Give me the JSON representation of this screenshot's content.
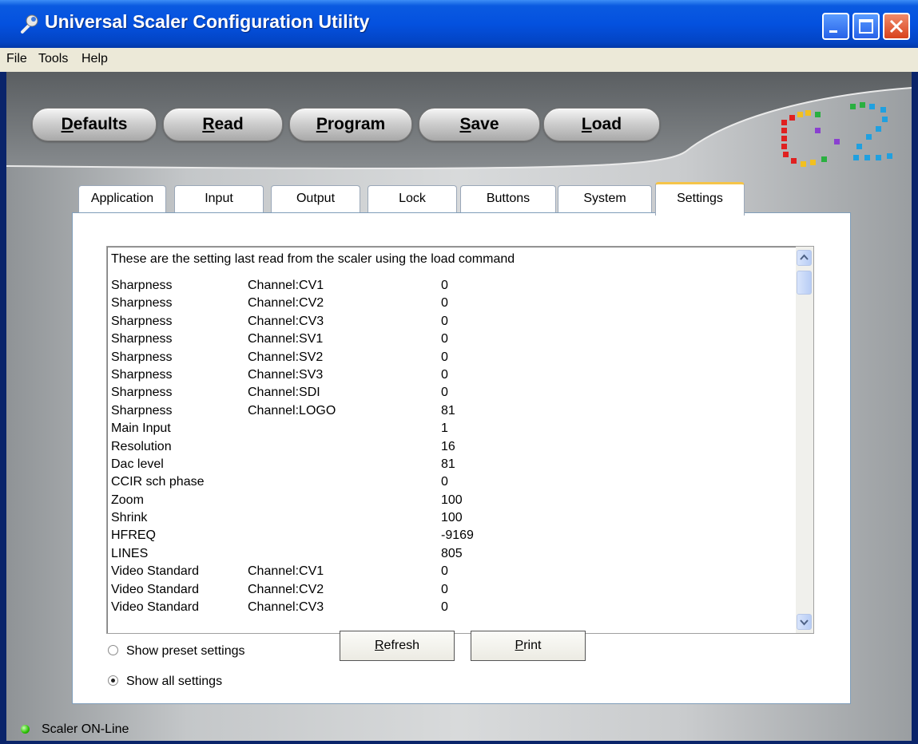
{
  "window": {
    "title": "Universal Scaler Configuration Utility"
  },
  "menu": [
    "File",
    "Tools",
    "Help"
  ],
  "toolbar": {
    "buttons": [
      {
        "label_u": "D",
        "label_rest": "efaults"
      },
      {
        "label_u": "R",
        "label_rest": "ead"
      },
      {
        "label_u": "P",
        "label_rest": "rogram"
      },
      {
        "label_u": "S",
        "label_rest": "ave"
      },
      {
        "label_u": "L",
        "label_rest": "oad"
      }
    ]
  },
  "tabs": [
    "Application",
    "Input",
    "Output",
    "Lock",
    "Buttons",
    "System",
    "Settings"
  ],
  "active_tab": "Settings",
  "settings": {
    "header": "These are the setting last read from the scaler using the load command",
    "rows": [
      {
        "name": "Sharpness",
        "channel": "Channel:CV1",
        "value": "0"
      },
      {
        "name": "Sharpness",
        "channel": "Channel:CV2",
        "value": "0"
      },
      {
        "name": "Sharpness",
        "channel": "Channel:CV3",
        "value": "0"
      },
      {
        "name": "Sharpness",
        "channel": "Channel:SV1",
        "value": "0"
      },
      {
        "name": "Sharpness",
        "channel": "Channel:SV2",
        "value": "0"
      },
      {
        "name": "Sharpness",
        "channel": "Channel:SV3",
        "value": "0"
      },
      {
        "name": "Sharpness",
        "channel": "Channel:SDI",
        "value": "0"
      },
      {
        "name": "Sharpness",
        "channel": "Channel:LOGO",
        "value": "81"
      },
      {
        "name": "Main Input",
        "channel": "",
        "value": "1"
      },
      {
        "name": "Resolution",
        "channel": "",
        "value": "16"
      },
      {
        "name": "Dac level",
        "channel": "",
        "value": "81"
      },
      {
        "name": "CCIR sch phase",
        "channel": "",
        "value": "0"
      },
      {
        "name": "Zoom",
        "channel": "",
        "value": "100"
      },
      {
        "name": "Shrink",
        "channel": "",
        "value": "100"
      },
      {
        "name": "HFREQ",
        "channel": "",
        "value": "-9169"
      },
      {
        "name": "LINES",
        "channel": "",
        "value": "805"
      },
      {
        "name": "Video Standard",
        "channel": "Channel:CV1",
        "value": "0"
      },
      {
        "name": "Video Standard",
        "channel": "Channel:CV2",
        "value": "0"
      },
      {
        "name": "Video Standard",
        "channel": "Channel:CV3",
        "value": "0"
      }
    ],
    "radio_preset": "Show preset settings",
    "radio_all": "Show all settings",
    "selected_radio": "all",
    "refresh_u": "R",
    "refresh_rest": "efresh",
    "print_u": "P",
    "print_rest": "rint"
  },
  "status": {
    "text": "Scaler ON-Line",
    "led_color": "#28c000"
  },
  "colors": {
    "title_bar": "#0451df",
    "active_tab_accent": "#f5c449"
  }
}
